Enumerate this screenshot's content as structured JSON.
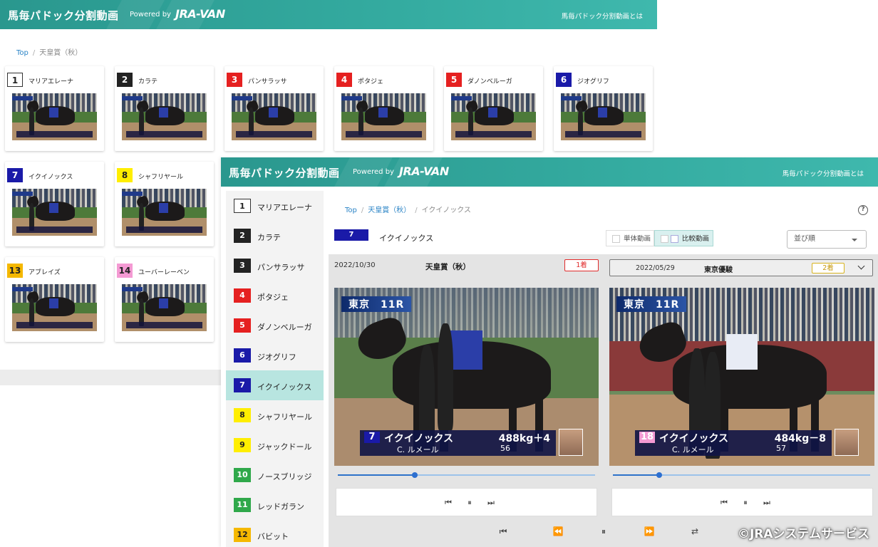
{
  "app": {
    "title": "馬毎パドック分割動画",
    "powered_by": "Powered by",
    "logo_text": "JRA-VAN",
    "about_link": "馬毎パドック分割動画とは",
    "accent_color": "#34aba0"
  },
  "back_window": {
    "breadcrumb": {
      "top": "Top",
      "current": "天皇賞（秋）"
    },
    "cards": [
      {
        "num": "1",
        "name": "マリアエレーナ",
        "bg": "#ffffff",
        "fg": "#222222"
      },
      {
        "num": "2",
        "name": "カラテ",
        "bg": "#222222",
        "fg": "#ffffff"
      },
      {
        "num": "3",
        "name": "パンサラッサ",
        "bg": "#e52020",
        "fg": "#ffffff"
      },
      {
        "num": "4",
        "name": "ポタジェ",
        "bg": "#e52020",
        "fg": "#ffffff"
      },
      {
        "num": "5",
        "name": "ダノンベルーガ",
        "bg": "#e52020",
        "fg": "#ffffff"
      },
      {
        "num": "6",
        "name": "ジオグリフ",
        "bg": "#1a1aa8",
        "fg": "#ffffff"
      },
      {
        "num": "7",
        "name": "イクイノックス",
        "bg": "#1a1aa8",
        "fg": "#ffffff"
      },
      {
        "num": "8",
        "name": "シャフリヤール",
        "bg": "#ffee00",
        "fg": "#222222"
      },
      {
        "num": "13",
        "name": "アブレイズ",
        "bg": "#f5b800",
        "fg": "#222222"
      },
      {
        "num": "14",
        "name": "ユーバーレーベン",
        "bg": "#f49ad3",
        "fg": "#222222"
      }
    ]
  },
  "front_window": {
    "breadcrumb": {
      "top": "Top",
      "race": "天皇賞（秋）",
      "current": "イクイノックス"
    },
    "help_icon": "?",
    "sidebar": [
      {
        "num": "1",
        "name": "マリアエレーナ",
        "bg": "#ffffff",
        "fg": "#222222",
        "active": false
      },
      {
        "num": "2",
        "name": "カラテ",
        "bg": "#222222",
        "fg": "#ffffff",
        "active": false
      },
      {
        "num": "3",
        "name": "パンサラッサ",
        "bg": "#222222",
        "fg": "#ffffff",
        "active": false
      },
      {
        "num": "4",
        "name": "ポタジェ",
        "bg": "#e52020",
        "fg": "#ffffff",
        "active": false
      },
      {
        "num": "5",
        "name": "ダノンベルーガ",
        "bg": "#e52020",
        "fg": "#ffffff",
        "active": false
      },
      {
        "num": "6",
        "name": "ジオグリフ",
        "bg": "#1a1aa8",
        "fg": "#ffffff",
        "active": false
      },
      {
        "num": "7",
        "name": "イクイノックス",
        "bg": "#1a1aa8",
        "fg": "#ffffff",
        "active": true
      },
      {
        "num": "8",
        "name": "シャフリヤール",
        "bg": "#ffee00",
        "fg": "#222222",
        "active": false
      },
      {
        "num": "9",
        "name": "ジャックドール",
        "bg": "#ffee00",
        "fg": "#222222",
        "active": false
      },
      {
        "num": "10",
        "name": "ノースブリッジ",
        "bg": "#2fa84a",
        "fg": "#ffffff",
        "active": false
      },
      {
        "num": "11",
        "name": "レッドガラン",
        "bg": "#2fa84a",
        "fg": "#ffffff",
        "active": false
      },
      {
        "num": "12",
        "name": "バビット",
        "bg": "#f5b800",
        "fg": "#222222",
        "active": false
      }
    ],
    "selected": {
      "num": "7",
      "name": "イクイノックス",
      "bg": "#1a1aa8"
    },
    "view_toggle": {
      "single": "単体動画",
      "compare": "比較動画"
    },
    "sort": {
      "value": "並び順"
    },
    "left_video": {
      "date": "2022/10/30",
      "race": "天皇賞（秋）",
      "result": "1着",
      "osd_location": "東京　11R",
      "horse_num": "7",
      "horse_num_bg": "#1a1aa8",
      "horse_name": "イクイノックス",
      "weight": "488kg＋4",
      "jockey": "C. ルメール",
      "kinryo": "56",
      "progress": 0.3
    },
    "right_video": {
      "date": "2022/05/29",
      "race": "東京優駿",
      "result": "2着",
      "osd_location": "東京　11R",
      "horse_num": "18",
      "horse_num_bg": "#f49ad3",
      "horse_name": "イクイノックス",
      "weight": "484kg－8",
      "jockey": "C. ルメール",
      "kinryo": "57",
      "progress": 0.18
    },
    "controls": {
      "prev": "⏮",
      "pause": "⏸",
      "next": "⏭",
      "step_back": "⏪",
      "step_fwd": "⏩",
      "loop": "⇄"
    },
    "copyright": "©JRAシステムサービス"
  }
}
